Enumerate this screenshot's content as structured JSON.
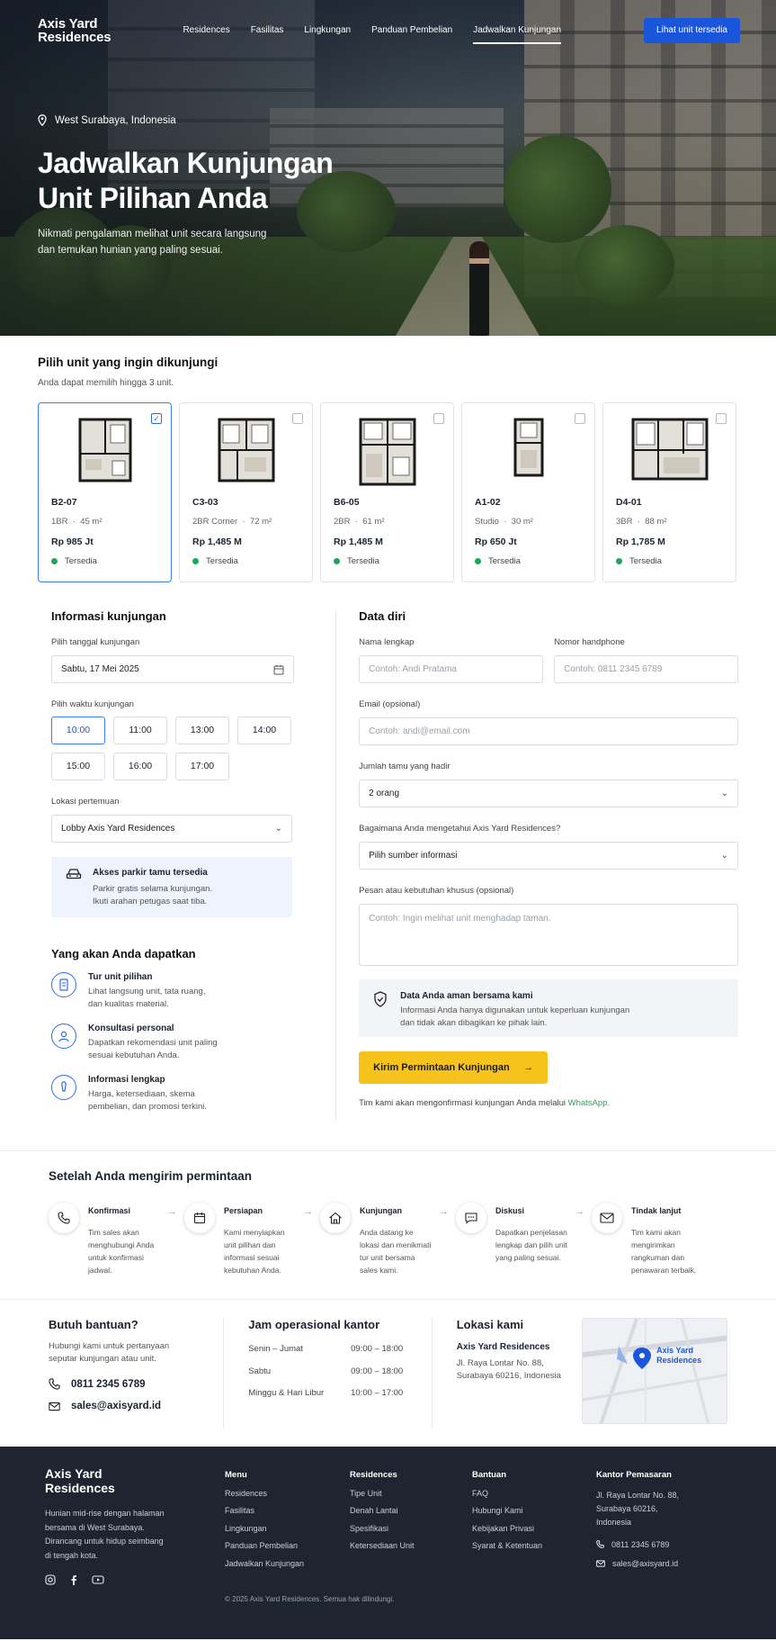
{
  "nav": {
    "logo_line1": "Axis Yard",
    "logo_line2": "Residences",
    "links": [
      "Residences",
      "Fasilitas",
      "Lingkungan",
      "Panduan Pembelian",
      "Jadwalkan Kunjungan"
    ],
    "cta": "Lihat unit tersedia"
  },
  "hero": {
    "location": "West Surabaya, Indonesia",
    "title_line1": "Jadwalkan Kunjungan",
    "title_line2": "Unit Pilihan Anda",
    "subtitle_line1": "Nikmati pengalaman melihat unit secara langsung",
    "subtitle_line2": "dan temukan hunian yang paling sesuai."
  },
  "units_section": {
    "title": "Pilih unit yang ingin dikunjungi",
    "hint": "Anda dapat memilih hingga 3 unit.",
    "units": [
      {
        "code": "B2-07",
        "type": "1BR",
        "size": "45 m²",
        "price": "Rp 985 Jt",
        "status": "Tersedia",
        "selected": true
      },
      {
        "code": "C3-03",
        "type": "2BR Corner",
        "size": "72 m²",
        "price": "Rp 1,485 M",
        "status": "Tersedia",
        "selected": false
      },
      {
        "code": "B6-05",
        "type": "2BR",
        "size": "61 m²",
        "price": "Rp 1,485 M",
        "status": "Tersedia",
        "selected": false
      },
      {
        "code": "A1-02",
        "type": "Studio",
        "size": "30 m²",
        "price": "Rp 650 Jt",
        "status": "Tersedia",
        "selected": false
      },
      {
        "code": "D4-01",
        "type": "3BR",
        "size": "88 m²",
        "price": "Rp 1,785 M",
        "status": "Tersedia",
        "selected": false
      }
    ]
  },
  "visit": {
    "title": "Informasi kunjungan",
    "date_label": "Pilih tanggal kunjungan",
    "date_value": "Sabtu, 17 Mei 2025",
    "time_label": "Pilih waktu kunjungan",
    "times": [
      "10:00",
      "11:00",
      "13:00",
      "14:00",
      "15:00",
      "16:00",
      "17:00"
    ],
    "selected_time": "10:00",
    "meeting_label": "Lokasi pertemuan",
    "meeting_value": "Lobby Axis Yard Residences",
    "parking_title": "Akses parkir tamu tersedia",
    "parking_line1": "Parkir gratis selama kunjungan.",
    "parking_line2": "Ikuti arahan petugas saat tiba."
  },
  "benefits": {
    "title": "Yang akan Anda dapatkan",
    "items": [
      {
        "title": "Tur unit pilihan",
        "line1": "Lihat langsung unit, tata ruang,",
        "line2": "dan kualitas material."
      },
      {
        "title": "Konsultasi personal",
        "line1": "Dapatkan rekomendasi unit paling",
        "line2": "sesuai kebutuhan Anda."
      },
      {
        "title": "Informasi lengkap",
        "line1": "Harga, ketersediaan, skema",
        "line2": "pembelian, dan promosi terkini."
      }
    ]
  },
  "personal": {
    "title": "Data diri",
    "name_label": "Nama lengkap",
    "name_placeholder": "Contoh: Andi Pratama",
    "phone_label": "Nomor handphone",
    "phone_placeholder": "Contoh: 0811 2345 6789",
    "email_label": "Email (opsional)",
    "email_placeholder": "Contoh: andi@email.com",
    "guests_label": "Jumlah tamu yang hadir",
    "guests_value": "2 orang",
    "source_label": "Bagaimana Anda mengetahui Axis Yard Residences?",
    "source_value": "Pilih sumber informasi",
    "message_label": "Pesan atau kebutuhan khusus (opsional)",
    "message_placeholder": "Contoh: Ingin melihat unit menghadap taman.",
    "secure_title": "Data Anda aman bersama kami",
    "secure_line1": "Informasi Anda hanya digunakan untuk keperluan kunjungan",
    "secure_line2": "dan tidak akan dibagikan ke pihak lain.",
    "submit": "Kirim Permintaan Kunjungan",
    "confirm_text": "Tim kami akan mengonfirmasi kunjungan Anda melalui",
    "confirm_link": "WhatsApp."
  },
  "after": {
    "title": "Setelah Anda mengirim permintaan",
    "steps": [
      {
        "title": "Konfirmasi",
        "desc": "Tim sales akan menghubungi Anda untuk konfirmasi jadwal.",
        "icon": "phone-icon"
      },
      {
        "title": "Persiapan",
        "desc": "Kami menyiapkan unit pilihan dan informasi sesuai kebutuhan Anda.",
        "icon": "calendar-icon"
      },
      {
        "title": "Kunjungan",
        "desc": "Anda datang ke lokasi dan menikmati tur unit bersama sales kami.",
        "icon": "home-icon"
      },
      {
        "title": "Diskusi",
        "desc": "Dapatkan penjelasan lengkap dan pilih unit yang paling sesuai.",
        "icon": "chat-icon"
      },
      {
        "title": "Tindak lanjut",
        "desc": "Tim kami akan mengirimkan rangkuman dan penawaran terbaik.",
        "icon": "mail-icon"
      }
    ]
  },
  "help": {
    "title": "Butuh bantuan?",
    "desc_line1": "Hubungi kami untuk pertanyaan",
    "desc_line2": "seputar kunjungan atau unit.",
    "phone": "0811 2345 6789",
    "email": "sales@axisyard.id",
    "hours_title": "Jam operasional kantor",
    "hours": [
      {
        "day": "Senin – Jumat",
        "time": "09:00 – 18:00"
      },
      {
        "day": "Sabtu",
        "time": "09:00 – 18:00"
      },
      {
        "day": "Minggu & Hari Libur",
        "time": "10:00 – 17:00"
      }
    ],
    "location_title": "Lokasi kami",
    "location_name": "Axis Yard Residences",
    "address_line1": "Jl. Raya Lontar No. 88,",
    "address_line2": "Surabaya 60216, Indonesia",
    "map_label_line1": "Axis Yard",
    "map_label_line2": "Residences"
  },
  "footer": {
    "logo_line1": "Axis Yard",
    "logo_line2": "Residences",
    "desc_lines": [
      "Hunian mid-rise dengan halaman",
      "bersama di West Surabaya.",
      "Dirancang untuk hidup seimbang",
      "di tengah kota."
    ],
    "menu_title": "Menu",
    "menu": [
      "Residences",
      "Fasilitas",
      "Lingkungan",
      "Panduan Pembelian",
      "Jadwalkan Kunjungan"
    ],
    "residences_title": "Residences",
    "residences": [
      "Tipe Unit",
      "Denah Lantai",
      "Spesifikasi",
      "Ketersediaan Unit"
    ],
    "support_title": "Bantuan",
    "support": [
      "FAQ",
      "Hubungi Kami",
      "Kebijakan Privasi",
      "Syarat & Ketentuan"
    ],
    "office_title": "Kantor Pemasaran",
    "office_lines": [
      "Jl. Raya Lontar No. 88,",
      "Surabaya 60216,",
      "Indonesia"
    ],
    "office_phone": "0811 2345 6789",
    "office_email": "sales@axisyard.id",
    "copyright": "© 2025 Axis Yard Residences. Semua hak dilindungi."
  },
  "colors": {
    "accent": "#1a56db",
    "cta_yellow": "#f6c31c",
    "available_green": "#22a45d",
    "footer_bg": "#1f2530"
  }
}
